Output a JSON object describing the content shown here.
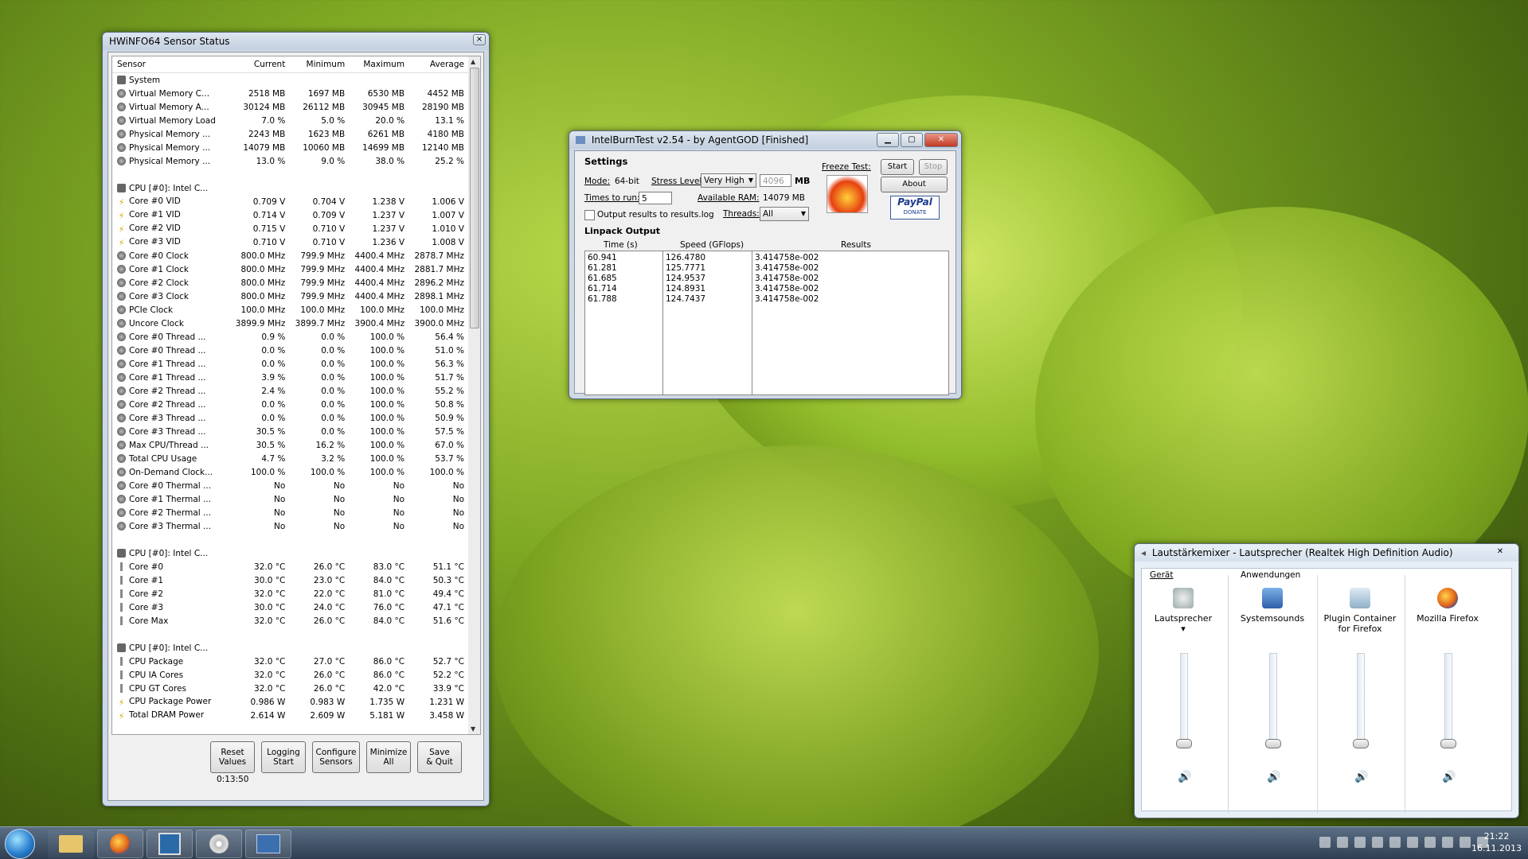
{
  "hwinfo": {
    "title": "HWiNFO64 Sensor Status",
    "close_glyph": "×",
    "columns": [
      "Sensor",
      "Current",
      "Minimum",
      "Maximum",
      "Average"
    ],
    "rows": [
      {
        "type": "group",
        "icon": "computer-icon",
        "name": "System",
        "cur": "",
        "min": "",
        "max": "",
        "avg": ""
      },
      {
        "icon": "gauge-icon",
        "name": "Virtual Memory C...",
        "cur": "2518 MB",
        "min": "1697 MB",
        "max": "6530 MB",
        "avg": "4452 MB"
      },
      {
        "icon": "gauge-icon",
        "name": "Virtual Memory A...",
        "cur": "30124 MB",
        "min": "26112 MB",
        "max": "30945 MB",
        "avg": "28190 MB"
      },
      {
        "icon": "gauge-icon",
        "name": "Virtual Memory Load",
        "cur": "7.0 %",
        "min": "5.0 %",
        "max": "20.0 %",
        "avg": "13.1 %"
      },
      {
        "icon": "gauge-icon",
        "name": "Physical Memory ...",
        "cur": "2243 MB",
        "min": "1623 MB",
        "max": "6261 MB",
        "avg": "4180 MB"
      },
      {
        "icon": "gauge-icon",
        "name": "Physical Memory ...",
        "cur": "14079 MB",
        "min": "10060 MB",
        "max": "14699 MB",
        "avg": "12140 MB"
      },
      {
        "icon": "gauge-icon",
        "name": "Physical Memory ...",
        "cur": "13.0 %",
        "min": "9.0 %",
        "max": "38.0 %",
        "avg": "25.2 %"
      },
      {
        "type": "blank",
        "name": "",
        "cur": "",
        "min": "",
        "max": "",
        "avg": ""
      },
      {
        "type": "group",
        "icon": "cpu-icon",
        "name": "CPU [#0]: Intel C...",
        "cur": "",
        "min": "",
        "max": "",
        "avg": ""
      },
      {
        "icon": "voltage-icon",
        "name": "Core #0 VID",
        "cur": "0.709 V",
        "min": "0.704 V",
        "max": "1.238 V",
        "avg": "1.006 V"
      },
      {
        "icon": "voltage-icon",
        "name": "Core #1 VID",
        "cur": "0.714 V",
        "min": "0.709 V",
        "max": "1.237 V",
        "avg": "1.007 V"
      },
      {
        "icon": "voltage-icon",
        "name": "Core #2 VID",
        "cur": "0.715 V",
        "min": "0.710 V",
        "max": "1.237 V",
        "avg": "1.010 V"
      },
      {
        "icon": "voltage-icon",
        "name": "Core #3 VID",
        "cur": "0.710 V",
        "min": "0.710 V",
        "max": "1.236 V",
        "avg": "1.008 V"
      },
      {
        "icon": "gauge-icon",
        "name": "Core #0 Clock",
        "cur": "800.0 MHz",
        "min": "799.9 MHz",
        "max": "4400.4 MHz",
        "avg": "2878.7 MHz"
      },
      {
        "icon": "gauge-icon",
        "name": "Core #1 Clock",
        "cur": "800.0 MHz",
        "min": "799.9 MHz",
        "max": "4400.4 MHz",
        "avg": "2881.7 MHz"
      },
      {
        "icon": "gauge-icon",
        "name": "Core #2 Clock",
        "cur": "800.0 MHz",
        "min": "799.9 MHz",
        "max": "4400.4 MHz",
        "avg": "2896.2 MHz"
      },
      {
        "icon": "gauge-icon",
        "name": "Core #3 Clock",
        "cur": "800.0 MHz",
        "min": "799.9 MHz",
        "max": "4400.4 MHz",
        "avg": "2898.1 MHz"
      },
      {
        "icon": "gauge-icon",
        "name": "PCIe Clock",
        "cur": "100.0 MHz",
        "min": "100.0 MHz",
        "max": "100.0 MHz",
        "avg": "100.0 MHz"
      },
      {
        "icon": "gauge-icon",
        "name": "Uncore Clock",
        "cur": "3899.9 MHz",
        "min": "3899.7 MHz",
        "max": "3900.4 MHz",
        "avg": "3900.0 MHz"
      },
      {
        "icon": "gauge-icon",
        "name": "Core #0 Thread ...",
        "cur": "0.9 %",
        "min": "0.0 %",
        "max": "100.0 %",
        "avg": "56.4 %"
      },
      {
        "icon": "gauge-icon",
        "name": "Core #0 Thread ...",
        "cur": "0.0 %",
        "min": "0.0 %",
        "max": "100.0 %",
        "avg": "51.0 %"
      },
      {
        "icon": "gauge-icon",
        "name": "Core #1 Thread ...",
        "cur": "0.0 %",
        "min": "0.0 %",
        "max": "100.0 %",
        "avg": "56.3 %"
      },
      {
        "icon": "gauge-icon",
        "name": "Core #1 Thread ...",
        "cur": "3.9 %",
        "min": "0.0 %",
        "max": "100.0 %",
        "avg": "51.7 %"
      },
      {
        "icon": "gauge-icon",
        "name": "Core #2 Thread ...",
        "cur": "2.4 %",
        "min": "0.0 %",
        "max": "100.0 %",
        "avg": "55.2 %"
      },
      {
        "icon": "gauge-icon",
        "name": "Core #2 Thread ...",
        "cur": "0.0 %",
        "min": "0.0 %",
        "max": "100.0 %",
        "avg": "50.8 %"
      },
      {
        "icon": "gauge-icon",
        "name": "Core #3 Thread ...",
        "cur": "0.0 %",
        "min": "0.0 %",
        "max": "100.0 %",
        "avg": "50.9 %"
      },
      {
        "icon": "gauge-icon",
        "name": "Core #3 Thread ...",
        "cur": "30.5 %",
        "min": "0.0 %",
        "max": "100.0 %",
        "avg": "57.5 %"
      },
      {
        "icon": "gauge-icon",
        "name": "Max CPU/Thread ...",
        "cur": "30.5 %",
        "min": "16.2 %",
        "max": "100.0 %",
        "avg": "67.0 %"
      },
      {
        "icon": "gauge-icon",
        "name": "Total CPU Usage",
        "cur": "4.7 %",
        "min": "3.2 %",
        "max": "100.0 %",
        "avg": "53.7 %"
      },
      {
        "icon": "gauge-icon",
        "name": "On-Demand Clock...",
        "cur": "100.0 %",
        "min": "100.0 %",
        "max": "100.0 %",
        "avg": "100.0 %"
      },
      {
        "icon": "gauge-icon",
        "name": "Core #0 Thermal ...",
        "cur": "No",
        "min": "No",
        "max": "No",
        "avg": "No"
      },
      {
        "icon": "gauge-icon",
        "name": "Core #1 Thermal ...",
        "cur": "No",
        "min": "No",
        "max": "No",
        "avg": "No"
      },
      {
        "icon": "gauge-icon",
        "name": "Core #2 Thermal ...",
        "cur": "No",
        "min": "No",
        "max": "No",
        "avg": "No"
      },
      {
        "icon": "gauge-icon",
        "name": "Core #3 Thermal ...",
        "cur": "No",
        "min": "No",
        "max": "No",
        "avg": "No"
      },
      {
        "type": "blank",
        "name": "",
        "cur": "",
        "min": "",
        "max": "",
        "avg": ""
      },
      {
        "type": "group",
        "icon": "cpu-icon",
        "name": "CPU [#0]: Intel C...",
        "cur": "",
        "min": "",
        "max": "",
        "avg": ""
      },
      {
        "icon": "thermometer-icon",
        "name": "Core #0",
        "cur": "32.0 °C",
        "min": "26.0 °C",
        "max": "83.0 °C",
        "avg": "51.1 °C"
      },
      {
        "icon": "thermometer-icon",
        "name": "Core #1",
        "cur": "30.0 °C",
        "min": "23.0 °C",
        "max": "84.0 °C",
        "avg": "50.3 °C"
      },
      {
        "icon": "thermometer-icon",
        "name": "Core #2",
        "cur": "32.0 °C",
        "min": "22.0 °C",
        "max": "81.0 °C",
        "avg": "49.4 °C"
      },
      {
        "icon": "thermometer-icon",
        "name": "Core #3",
        "cur": "30.0 °C",
        "min": "24.0 °C",
        "max": "76.0 °C",
        "avg": "47.1 °C"
      },
      {
        "icon": "thermometer-icon",
        "name": "Core Max",
        "cur": "32.0 °C",
        "min": "26.0 °C",
        "max": "84.0 °C",
        "avg": "51.6 °C"
      },
      {
        "type": "blank",
        "name": "",
        "cur": "",
        "min": "",
        "max": "",
        "avg": ""
      },
      {
        "type": "group",
        "icon": "cpu-icon",
        "name": "CPU [#0]: Intel C...",
        "cur": "",
        "min": "",
        "max": "",
        "avg": ""
      },
      {
        "icon": "thermometer-icon",
        "name": "CPU Package",
        "cur": "32.0 °C",
        "min": "27.0 °C",
        "max": "86.0 °C",
        "avg": "52.7 °C"
      },
      {
        "icon": "thermometer-icon",
        "name": "CPU IA Cores",
        "cur": "32.0 °C",
        "min": "26.0 °C",
        "max": "86.0 °C",
        "avg": "52.2 °C"
      },
      {
        "icon": "thermometer-icon",
        "name": "CPU GT Cores",
        "cur": "32.0 °C",
        "min": "26.0 °C",
        "max": "42.0 °C",
        "avg": "33.9 °C"
      },
      {
        "icon": "voltage-icon",
        "name": "CPU Package Power",
        "cur": "0.986 W",
        "min": "0.983 W",
        "max": "1.735 W",
        "avg": "1.231 W"
      },
      {
        "icon": "voltage-icon",
        "name": "Total DRAM Power",
        "cur": "2.614 W",
        "min": "2.609 W",
        "max": "5.181 W",
        "avg": "3.458 W"
      }
    ],
    "buttons": [
      {
        "name": "reset-values-button",
        "label": "Reset\nValues"
      },
      {
        "name": "logging-start-button",
        "label": "Logging\nStart"
      },
      {
        "name": "configure-sensors-button",
        "label": "Configure\nSensors"
      },
      {
        "name": "minimize-all-button",
        "label": "Minimize\nAll"
      },
      {
        "name": "save-quit-button",
        "label": "Save\n& Quit"
      }
    ],
    "timer": "0:13:50"
  },
  "ibt": {
    "title": "IntelBurnTest v2.54 - by AgentGOD [Finished]",
    "settings_label": "Settings",
    "mode_label": "Mode:",
    "mode_value": "64-bit",
    "stress_label": "Stress Level:",
    "stress_value": "Very High",
    "mem_value": "4096",
    "mb_label": "MB",
    "times_label": "Times to run:",
    "times_value": "5",
    "avail_label": "Available RAM:",
    "avail_value": "14079 MB",
    "output_check_label": "Output results to results.log",
    "threads_label": "Threads:",
    "threads_value": "All",
    "freeze_label": "Freeze Test:",
    "start_label": "Start",
    "stop_label": "Stop",
    "about_label": "About",
    "paypal_label": "PayPal",
    "donate_label": "DONATE",
    "linpack_label": "Linpack Output",
    "col_time": "Time (s)",
    "col_speed": "Speed (GFlops)",
    "col_results": "Results",
    "times": [
      "60.941",
      "61.281",
      "61.685",
      "61.714",
      "61.788"
    ],
    "speeds": [
      "126.4780",
      "125.7771",
      "124.9537",
      "124.8931",
      "124.7437"
    ],
    "results": [
      "3.414758e-002",
      "3.414758e-002",
      "3.414758e-002",
      "3.414758e-002",
      "3.414758e-002"
    ]
  },
  "mixer": {
    "title": "Lautstärkemixer - Lautsprecher (Realtek High Definition Audio)",
    "device_header": "Gerät",
    "apps_header": "Anwendungen",
    "channels": [
      {
        "name": "speaker-channel",
        "icon": "speaker-device-icon",
        "label": "Lautsprecher",
        "level": 0.0
      },
      {
        "name": "systemsounds-channel",
        "icon": "system-sounds-icon",
        "label": "Systemsounds",
        "level": 0.0
      },
      {
        "name": "plugin-container-channel",
        "icon": "plugin-container-icon",
        "label": "Plugin Container\nfor Firefox",
        "level": 0.0
      },
      {
        "name": "firefox-channel",
        "icon": "firefox-icon",
        "label": "Mozilla Firefox",
        "level": 0.0
      }
    ]
  },
  "taskbar": {
    "items": [
      "explorer-icon",
      "firefox-icon",
      "hwinfo-icon",
      "cd-icon",
      "cpu-z-icon"
    ],
    "time": "21:22",
    "date": "16.11.2013"
  }
}
